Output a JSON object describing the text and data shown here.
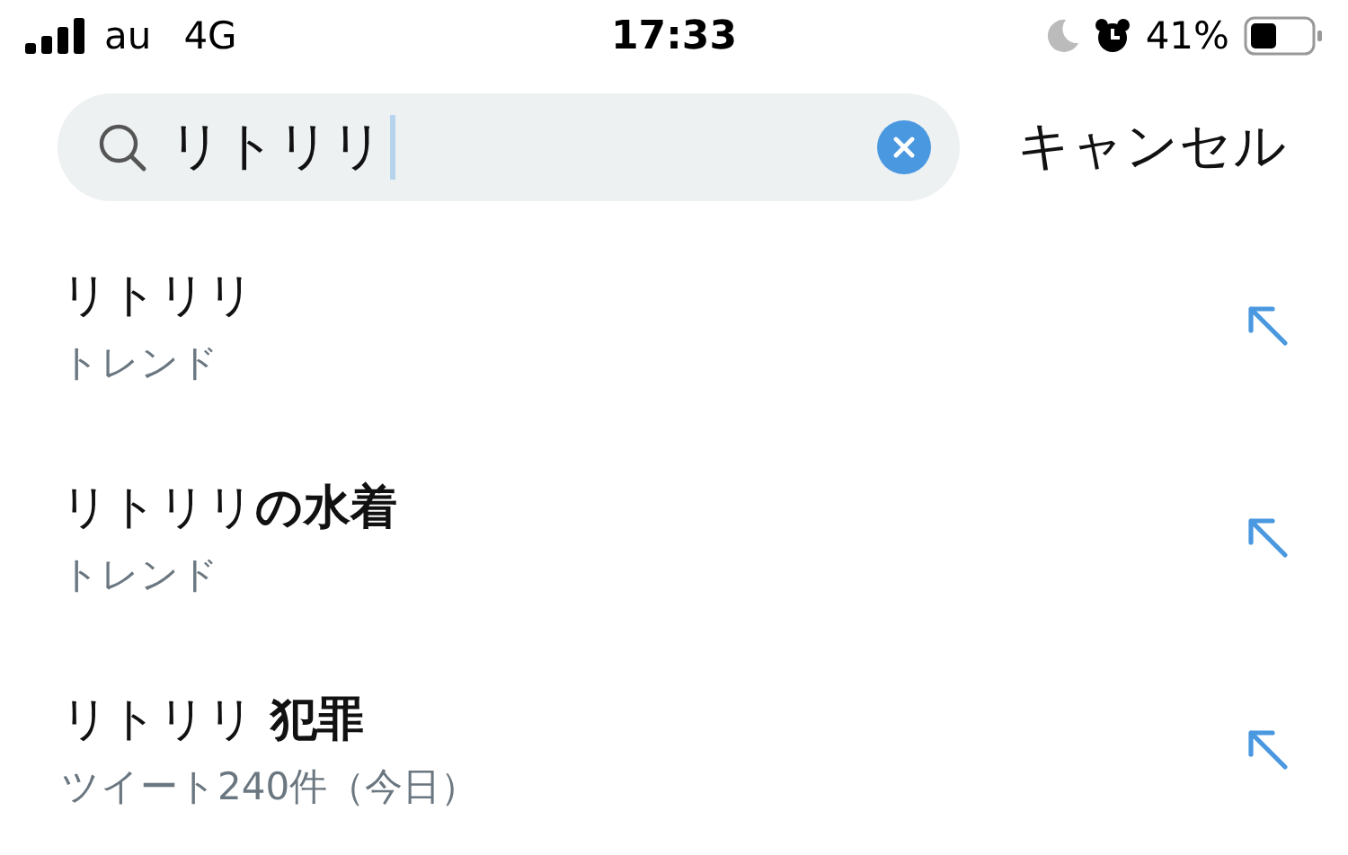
{
  "status_bar": {
    "carrier": "au",
    "network": "4G",
    "time": "17:33",
    "battery": "41%"
  },
  "search": {
    "value": "リトリリ",
    "cancel": "キャンセル"
  },
  "suggestions": [
    {
      "title": "リトリリ",
      "subtitle": "トレンド"
    },
    {
      "title": "リトリリ**の水着**",
      "subtitle": "トレンド"
    },
    {
      "title": "リトリリ **犯罪**",
      "subtitle": "ツイート240件（今日）"
    }
  ]
}
